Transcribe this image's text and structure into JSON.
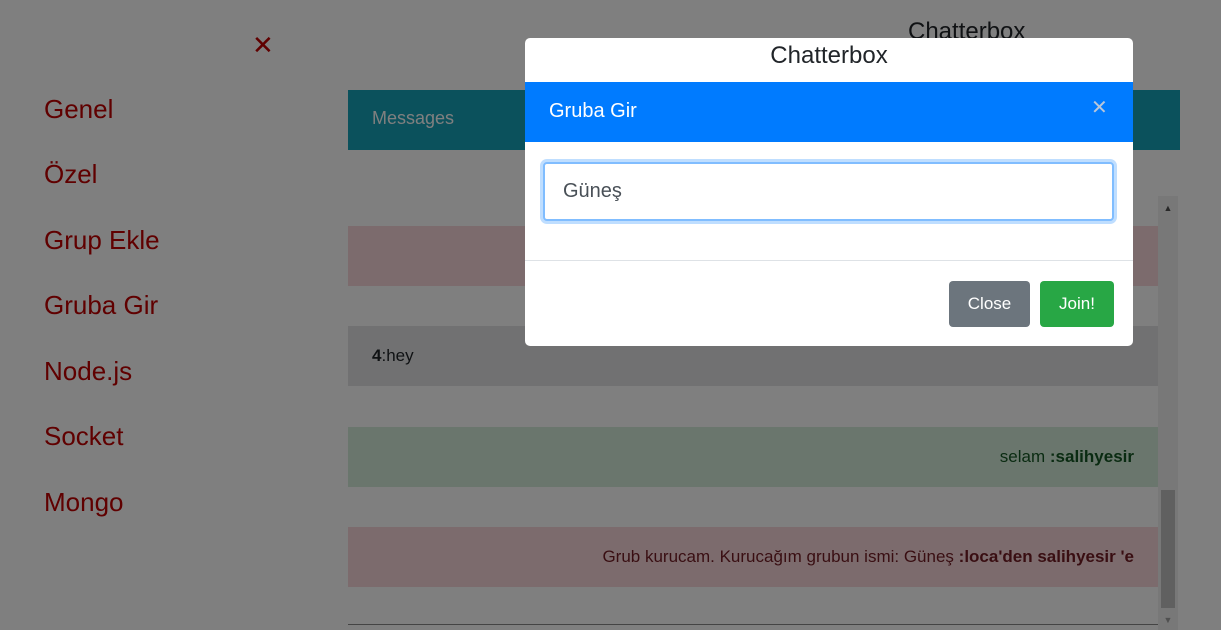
{
  "app": {
    "title": "Chatterbox"
  },
  "messages_panel": {
    "header": "Messages"
  },
  "messages": [
    {
      "kind": "danger",
      "text": "",
      "sender": ""
    },
    {
      "kind": "light",
      "sender": "4",
      "text": " :hey"
    },
    {
      "kind": "success",
      "text": "selam ",
      "sender": ":salihyesir"
    },
    {
      "kind": "danger",
      "text": "Grub kurucam. Kurucağım grubun ismi: Güneş ",
      "sender": ":loca'den salihyesir 'e"
    }
  ],
  "sidebar": {
    "close_icon": "close-icon",
    "items": [
      {
        "label": "Genel"
      },
      {
        "label": "Özel"
      },
      {
        "label": "Grup Ekle"
      },
      {
        "label": "Gruba Gir"
      },
      {
        "label": "Node.js"
      },
      {
        "label": "Socket"
      },
      {
        "label": "Mongo"
      }
    ]
  },
  "modal": {
    "top_title": "Chatterbox",
    "title": "Gruba Gir",
    "close_icon": "close-icon",
    "input_value": "Güneş",
    "close_label": "Close",
    "join_label": "Join!"
  },
  "colors": {
    "primary": "#007bff",
    "info": "#17a2b8",
    "success": "#28a745",
    "secondary": "#6c757d",
    "nav_text": "#c00000"
  }
}
